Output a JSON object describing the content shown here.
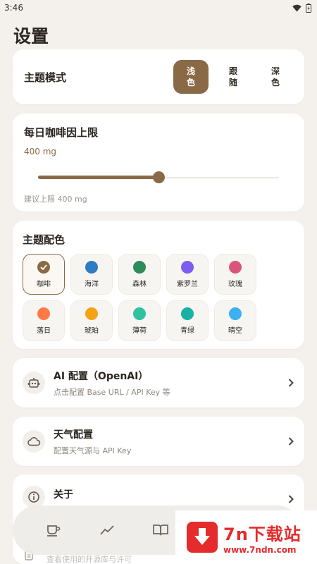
{
  "status_bar": {
    "time": "3:46"
  },
  "page_title": "设置",
  "theme_mode": {
    "title": "主题模式",
    "options": [
      {
        "label": "浅色",
        "active": true
      },
      {
        "label": "跟随",
        "active": false
      },
      {
        "label": "深色",
        "active": false
      }
    ]
  },
  "caffeine": {
    "title": "每日咖啡因上限",
    "value_label": "400 mg",
    "slider_fraction": 0.5,
    "hint": "建议上限 400 mg"
  },
  "theme_color": {
    "title": "主题配色",
    "swatches": [
      {
        "name": "咖啡",
        "color": "#8a6a46",
        "selected": true
      },
      {
        "name": "海洋",
        "color": "#2f7bc4",
        "selected": false
      },
      {
        "name": "森林",
        "color": "#2e8b5a",
        "selected": false
      },
      {
        "name": "紫罗兰",
        "color": "#7d5cf0",
        "selected": false
      },
      {
        "name": "玫瑰",
        "color": "#d9557a",
        "selected": false
      },
      {
        "name": "落日",
        "color": "#ff7a45",
        "selected": false
      },
      {
        "name": "琥珀",
        "color": "#f5a216",
        "selected": false
      },
      {
        "name": "薄荷",
        "color": "#2ec2a0",
        "selected": false
      },
      {
        "name": "青绿",
        "color": "#17b2a5",
        "selected": false
      },
      {
        "name": "晴空",
        "color": "#3bb0f2",
        "selected": false
      }
    ]
  },
  "ai_config": {
    "title": "AI 配置（OpenAI）",
    "subtitle": "点击配置 Base URL / API Key 等",
    "icon": "robot-icon"
  },
  "weather_config": {
    "title": "天气配置",
    "subtitle": "配置天气源与 API Key",
    "icon": "cloud-icon"
  },
  "about": {
    "title": "关于",
    "icon": "info-icon"
  },
  "licenses": {
    "subtitle": "查看使用的开源库与许可"
  },
  "bottom_nav": [
    "coffee-cup-icon",
    "trend-icon",
    "book-icon"
  ],
  "watermark": {
    "name": "7n下载站",
    "url": "www.7ndn.com"
  },
  "colors": {
    "accent": "#8a6a46",
    "background": "#f4f1ec"
  }
}
